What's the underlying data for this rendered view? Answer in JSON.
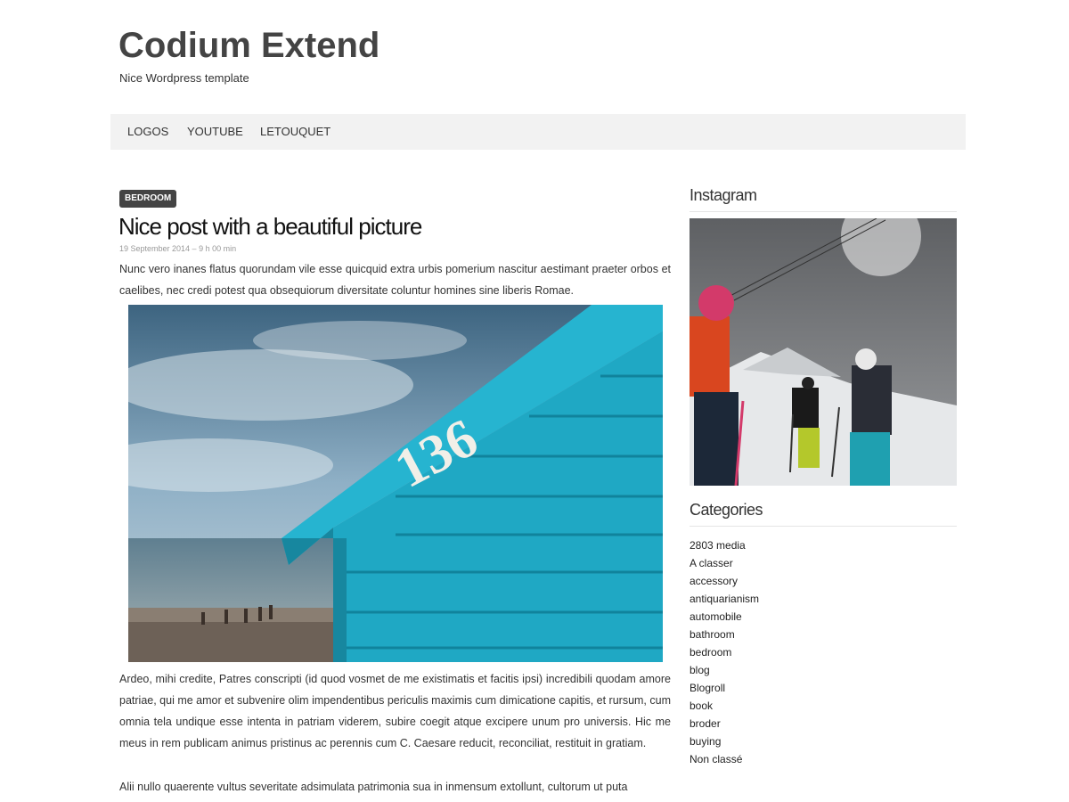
{
  "site": {
    "title": "Codium Extend",
    "description": "Nice Wordpress template"
  },
  "nav": {
    "items": [
      {
        "label": "LOGOS"
      },
      {
        "label": "YOUTUBE"
      },
      {
        "label": "LETOUQUET"
      }
    ]
  },
  "post": {
    "category": "BEDROOM",
    "title": "Nice post with a beautiful picture",
    "meta": "19 September 2014 – 9 h 00 min",
    "intro": "Nunc vero inanes flatus quorundam vile esse quicquid extra urbis pomerium nascitur aestimant praeter orbos et caelibes, nec credi potest qua obsequiorum diversitate coluntur homines sine liberis Romae.",
    "image_number": "136",
    "body_1": "Ardeo, mihi credite, Patres conscripti (id quod vosmet de me existimatis et facitis ipsi) incredibili quodam amore patriae, qui me amor et subvenire olim impendentibus periculis maximis cum dimicatione capitis, et rursum, cum omnia tela undique esse intenta in patriam viderem, subire coegit atque excipere unum pro universis. Hic me meus in rem publicam animus pristinus ac perennis cum C. Caesare reducit, reconciliat, restituit in gratiam.",
    "body_2": "Alii nullo quaerente vultus severitate adsimulata patrimonia sua in inmensum extollunt, cultorum ut puta"
  },
  "sidebar": {
    "instagram_title": "Instagram",
    "categories_title": "Categories",
    "categories": [
      "2803 media",
      "A classer",
      "accessory",
      "antiquarianism",
      "automobile",
      "bathroom",
      "bedroom",
      "blog",
      "Blogroll",
      "book",
      "broder",
      "buying",
      "Non classé"
    ]
  },
  "colors": {
    "nav_bg": "#f2f2f2",
    "badge_bg": "#444444",
    "hut_blue": "#1fa8c4"
  }
}
